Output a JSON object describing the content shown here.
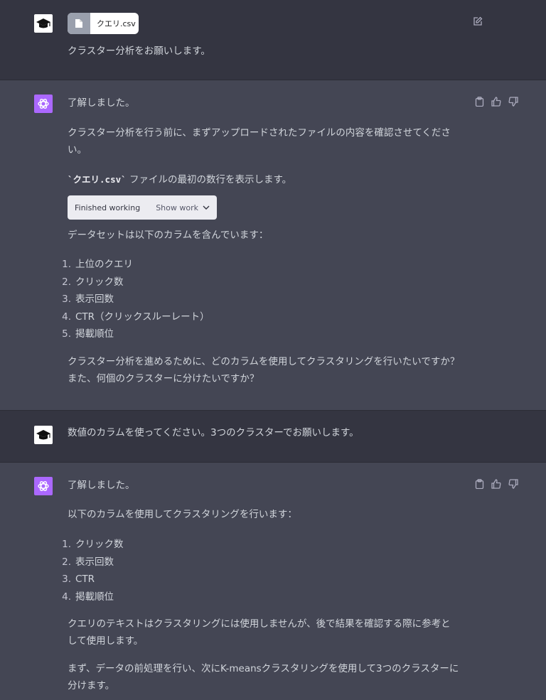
{
  "turns": {
    "u1": {
      "file_name": "クエリ.csv",
      "text": "クラスター分析をお願いします。"
    },
    "a1": {
      "p1": "了解しました。",
      "p2_line1": "クラスター分析を行う前に、まずアップロードされたファイルの内容を確認させてくださ",
      "p2_line2": "い。",
      "p3_code": "`クエリ.csv`",
      "p3_rest": " ファイルの最初の数行を表示します。",
      "work_label": "Finished working",
      "work_toggle": "Show work",
      "p4": "データセットは以下のカラムを含んでいます：",
      "list": [
        {
          "num": "1.",
          "text": "上位のクエリ"
        },
        {
          "num": "2.",
          "text": "クリック数"
        },
        {
          "num": "3.",
          "text": "表示回数"
        },
        {
          "num": "4.",
          "text": "CTR（クリックスルーレート）"
        },
        {
          "num": "5.",
          "text": "掲載順位"
        }
      ],
      "p5_line1": "クラスター分析を進めるために、どのカラムを使用してクラスタリングを行いたいですか？",
      "p5_line2": "また、何個のクラスターに分けたいですか？"
    },
    "u2": {
      "text": "数値のカラムを使ってください。3つのクラスターでお願いします。"
    },
    "a2": {
      "p1": "了解しました。",
      "p2": "以下のカラムを使用してクラスタリングを行います：",
      "list": [
        {
          "num": "1.",
          "text": "クリック数"
        },
        {
          "num": "2.",
          "text": "表示回数"
        },
        {
          "num": "3.",
          "text": "CTR"
        },
        {
          "num": "4.",
          "text": "掲載順位"
        }
      ],
      "p3_line1": "クエリのテキストはクラスタリングには使用しませんが、後で結果を確認する際に参考と",
      "p3_line2": "して使用します。",
      "p4_line1": "まず、データの前処理を行い、次にK-meansクラスタリングを使用して3つのクラスターに",
      "p4_line2": "分けます。"
    }
  },
  "icons": {
    "edit": "edit-icon",
    "copy": "clipboard-icon",
    "like": "thumbs-up-icon",
    "dislike": "thumbs-down-icon",
    "user_avatar": "graduation-cap-icon",
    "assistant_avatar": "openai-logo-icon",
    "file": "file-icon",
    "chevron": "chevron-down-icon"
  },
  "colors": {
    "user_bg": "#343541",
    "assistant_bg": "#444654",
    "assistant_avatar": "#ab68ff"
  }
}
